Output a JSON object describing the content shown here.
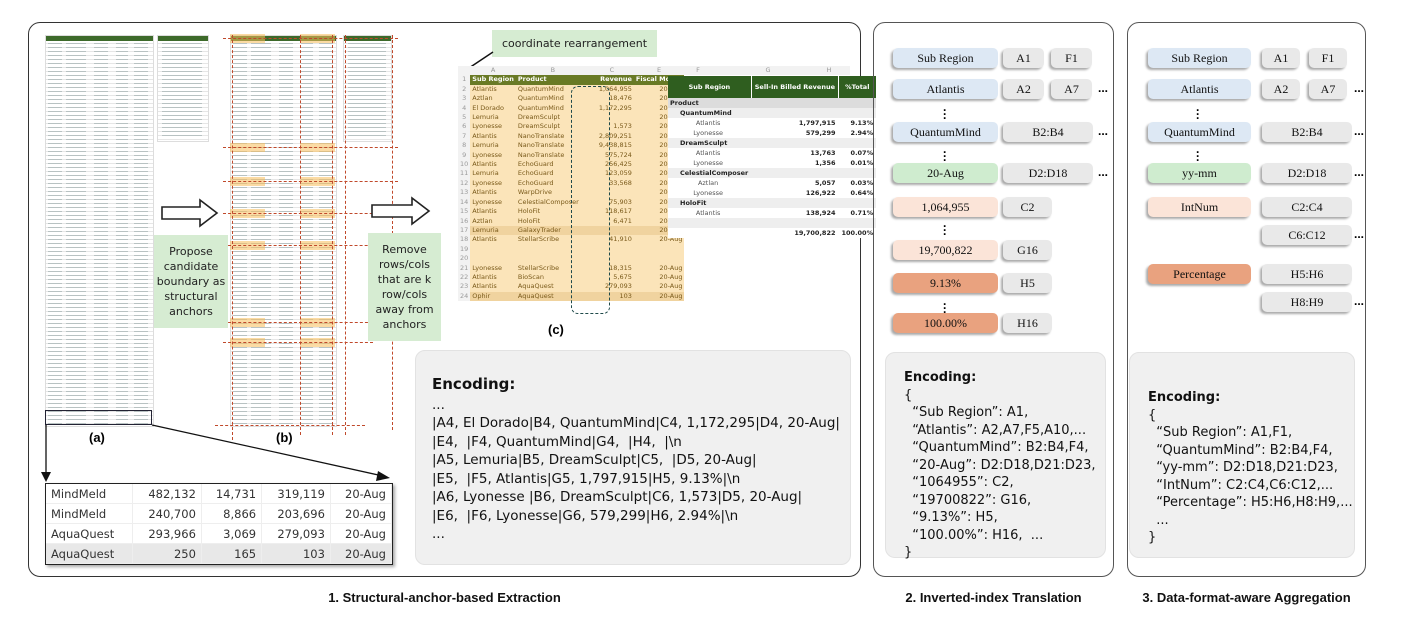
{
  "panel1": {
    "caption": "1. Structural-anchor-based Extraction",
    "note_propose": "Propose candidate boundary as structural anchors",
    "note_remove": "Remove rows/cols that are k row/cols away from anchors",
    "note_coord": "coordinate rearrangement",
    "label_a": "(a)",
    "label_b": "(b)",
    "label_c": "(c)",
    "zoom_table": [
      [
        "MindMeld",
        "482,132",
        "14,731",
        "319,119",
        "20-Aug"
      ],
      [
        "MindMeld",
        "240,700",
        "8,866",
        "203,696",
        "20-Aug"
      ],
      [
        "AquaQuest",
        "293,966",
        "3,069",
        "279,093",
        "20-Aug"
      ],
      [
        "AquaQuest",
        "250",
        "165",
        "103",
        "20-Aug"
      ]
    ],
    "sheet": {
      "col_letters": [
        "A",
        "B",
        "C",
        "D",
        "E",
        "F",
        "G",
        "H"
      ],
      "headers": [
        "Sub Region",
        "Product",
        "Revenue",
        "Fiscal Month"
      ],
      "rows": [
        [
          "Atlantis",
          "QuantumMind",
          "1,064,955",
          "20-Aug"
        ],
        [
          "Aztlan",
          "QuantumMind",
          "18,476",
          "20-Aug"
        ],
        [
          "El Dorado",
          "QuantumMind",
          "1,172,295",
          "20-Aug"
        ],
        [
          "Lemuria",
          "DreamSculpt",
          "",
          "20-Aug"
        ],
        [
          "Lyonesse",
          "DreamSculpt",
          "1,573",
          "20-Aug"
        ],
        [
          "Atlantis",
          "NanoTranslate",
          "2,809,251",
          "20-Aug"
        ],
        [
          "Lemuria",
          "NanoTranslate",
          "9,438,815",
          "20-Aug"
        ],
        [
          "Lyonesse",
          "NanoTranslate",
          "575,724",
          "20-Aug"
        ],
        [
          "Atlantis",
          "EchoGuard",
          "256,425",
          "20-Aug"
        ],
        [
          "Lemuria",
          "EchoGuard",
          "123,059",
          "20-Aug"
        ],
        [
          "Lyonesse",
          "EchoGuard",
          "33,568",
          "20-Aug"
        ],
        [
          "Atlantis",
          "WarpDrive",
          "",
          "20-Aug"
        ],
        [
          "Lyonesse",
          "CelestialComposer",
          "75,903",
          "20-Aug"
        ],
        [
          "Atlantis",
          "HoloFit",
          "118,617",
          "20-Aug"
        ],
        [
          "Aztlan",
          "HoloFit",
          "6,471",
          "20-Aug"
        ],
        [
          "Lemuria",
          "GalaxyTrader",
          "",
          "20-Aug"
        ],
        [
          "Atlantis",
          "StellarScribe",
          "41,910",
          "20-Aug"
        ],
        [
          "",
          "",
          "",
          ""
        ],
        [
          "",
          "",
          "",
          ""
        ],
        [
          "Lyonesse",
          "StellarScribe",
          "18,315",
          "20-Aug"
        ],
        [
          "Atlantis",
          "BioScan",
          "5,675",
          "20-Aug"
        ],
        [
          "Atlantis",
          "AquaQuest",
          "279,093",
          "20-Aug"
        ],
        [
          "Ophir",
          "AquaQuest",
          "103",
          "20-Aug"
        ]
      ],
      "pivot_headers": [
        "Sub Region",
        "Sell-In Billed Revenue",
        "%Total"
      ],
      "pivot_rows": [
        {
          "label": "Product",
          "level": 0,
          "value": "",
          "pct": ""
        },
        {
          "label": "QuantumMind",
          "level": 1,
          "value": "",
          "pct": ""
        },
        {
          "label": "Atlantis",
          "level": 2,
          "value": "1,797,915",
          "pct": "9.13%"
        },
        {
          "label": "Lyonesse",
          "level": 2,
          "value": "579,299",
          "pct": "2.94%"
        },
        {
          "label": "DreamSculpt",
          "level": 1,
          "value": "",
          "pct": ""
        },
        {
          "label": "Atlantis",
          "level": 2,
          "value": "13,763",
          "pct": "0.07%"
        },
        {
          "label": "Lyonesse",
          "level": 2,
          "value": "1,356",
          "pct": "0.01%"
        },
        {
          "label": "CelestialComposer",
          "level": 1,
          "value": "",
          "pct": ""
        },
        {
          "label": "Aztlan",
          "level": 2,
          "value": "5,057",
          "pct": "0.03%"
        },
        {
          "label": "Lyonesse",
          "level": 2,
          "value": "126,922",
          "pct": "0.64%"
        },
        {
          "label": "HoloFit",
          "level": 1,
          "value": "",
          "pct": ""
        },
        {
          "label": "Atlantis",
          "level": 2,
          "value": "138,924",
          "pct": "0.71%"
        },
        {
          "label": "",
          "level": 1,
          "value": "",
          "pct": ""
        },
        {
          "label": "",
          "level": 2,
          "value": "19,700,822",
          "pct": "100.00%"
        }
      ]
    },
    "encoding": {
      "title": "Encoding:",
      "lines": [
        "...",
        "|A4, El Dorado|B4, QuantumMind|C4, 1,172,295|D4, 20-Aug|",
        "|E4,  |F4, QuantumMind|G4,  |H4,  |\\n",
        "|A5, Lemuria|B5, DreamSculpt|C5,  |D5, 20-Aug|",
        "|E5,  |F5, Atlantis|G5, 1,797,915|H5, 9.13%|\\n",
        "|A6, Lyonesse |B6, DreamSculpt|C6, 1,573|D5, 20-Aug|",
        "|E6,  |F6, Lyonesse|G6, 579,299|H6, 2.94%|\\n",
        "..."
      ]
    }
  },
  "panel2": {
    "caption": "2. Inverted-index Translation",
    "entries": [
      {
        "value": "Sub Region",
        "color": "blue",
        "refs": [
          "A1",
          "F1"
        ],
        "more": ""
      },
      {
        "value": "Atlantis",
        "color": "blue",
        "refs": [
          "A2",
          "A7"
        ],
        "more": "..."
      },
      {
        "value": "QuantumMind",
        "color": "blue",
        "refs": [
          "B2:B4"
        ],
        "more": "..."
      },
      {
        "value": "20-Aug",
        "color": "green",
        "refs": [
          "D2:D18"
        ],
        "more": "..."
      },
      {
        "value": "1,064,955",
        "color": "peach",
        "refs": [
          "C2"
        ],
        "more": ""
      },
      {
        "value": "19,700,822",
        "color": "peach",
        "refs": [
          "G16"
        ],
        "more": ""
      },
      {
        "value": "9.13%",
        "color": "orange",
        "refs": [
          "H5"
        ],
        "more": ""
      },
      {
        "value": "100.00%",
        "color": "orange",
        "refs": [
          "H16"
        ],
        "more": ""
      }
    ],
    "encoding": {
      "title": "Encoding:",
      "lines": [
        "{",
        "  “Sub Region”: A1,",
        "  “Atlantis”: A2,A7,F5,A10,...",
        "  “QuantumMind”: B2:B4,F4,",
        "  “20-Aug”: D2:D18,D21:D23,",
        "  “1064955”: C2,",
        "  “19700822”: G16,",
        "  “9.13%”: H5,",
        "  “100.00%”: H16,  ...",
        "}"
      ]
    }
  },
  "panel3": {
    "caption": "3. Data-format-aware Aggregation",
    "entries": [
      {
        "value": "Sub Region",
        "color": "blue",
        "refs": [
          "A1",
          "F1"
        ],
        "more": ""
      },
      {
        "value": "Atlantis",
        "color": "blue",
        "refs": [
          "A2",
          "A7"
        ],
        "more": "..."
      },
      {
        "value": "QuantumMind",
        "color": "blue",
        "refs": [
          "B2:B4"
        ],
        "more": "..."
      },
      {
        "value": "yy-mm",
        "color": "green",
        "refs": [
          "D2:D18"
        ],
        "more": "..."
      },
      {
        "value": "IntNum",
        "color": "peach",
        "refs": [
          "C2:C4"
        ],
        "more": ""
      },
      {
        "value": "",
        "color": "",
        "refs": [
          "C6:C12"
        ],
        "more": "..."
      },
      {
        "value": "Percentage",
        "color": "orange",
        "refs": [
          "H5:H6"
        ],
        "more": ""
      },
      {
        "value": "",
        "color": "",
        "refs": [
          "H8:H9"
        ],
        "more": "..."
      }
    ],
    "encoding": {
      "title": "Encoding:",
      "lines": [
        "{",
        "  “Sub Region”: A1,F1,",
        "  “QuantumMind”: B2:B4,F4,",
        "  “yy-mm”: D2:D18,D21:D23,",
        "  “IntNum”: C2:C4,C6:C12,...",
        "  “Percentage”: H5:H6,H8:H9,...",
        "  ...",
        "}"
      ]
    }
  },
  "colors": {
    "value_blue": "#dde8f4",
    "value_green": "#cfeccf",
    "value_peach": "#fbe4d8",
    "value_orange": "#e9a27f",
    "ref_grey": "#e9e9e9",
    "note_green": "#d6ecd2",
    "anchor_line": "#c0492b",
    "sheet_header": "#697a25",
    "pivot_header": "#2f5e1f"
  }
}
